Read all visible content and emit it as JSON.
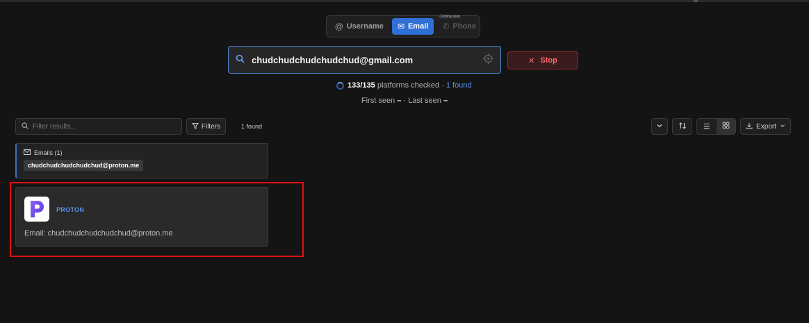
{
  "modes": {
    "username": "Username",
    "email": "Email",
    "phone": "Phone",
    "phone_badge": "Coming soon"
  },
  "search": {
    "value": "chudchudchudchudchud@gmail.com"
  },
  "stop_label": "Stop",
  "progress": {
    "checked": "133",
    "total": "/135",
    "text": " platforms checked · ",
    "found": "1 found"
  },
  "seen": {
    "first_label": "First seen",
    "first_value": "–",
    "sep": " · ",
    "last_label": "Last seen",
    "last_value": "–"
  },
  "toolbar": {
    "filter_placeholder": "Filter results...",
    "filters_label": "Filters",
    "count": "1 found",
    "export_label": "Export"
  },
  "emails": {
    "heading": "Emails (1)",
    "items": [
      "chudchudchudchudchud@proton.me"
    ]
  },
  "result": {
    "platform": "PROTON",
    "email_line": "Email: chudchudchudchudchud@proton.me"
  },
  "colors": {
    "accent": "#2f6fd6",
    "link": "#5a8fe8",
    "stop": "#ff6a6a",
    "highlight": "#e01010"
  }
}
